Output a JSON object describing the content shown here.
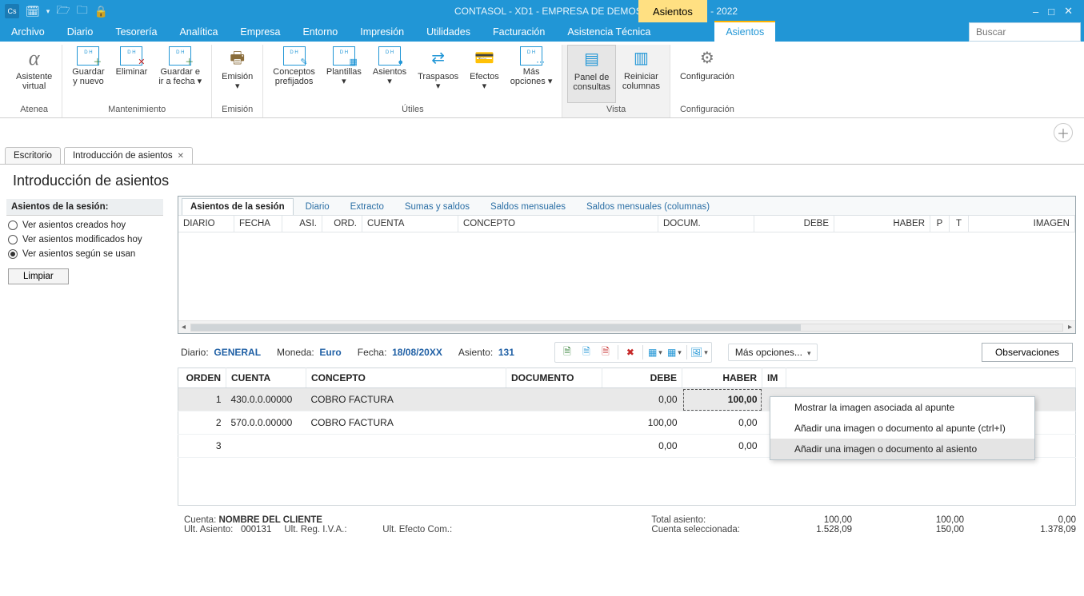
{
  "title": "CONTASOL - XD1 - EMPRESA DE DEMOSTRACION, S.L. - 2022",
  "context_tab": "Asientos",
  "window_buttons": {
    "min": "–",
    "max": "□",
    "close": "✕"
  },
  "search_placeholder": "Buscar",
  "menu": [
    "Archivo",
    "Diario",
    "Tesorería",
    "Analítica",
    "Empresa",
    "Entorno",
    "Impresión",
    "Utilidades",
    "Facturación",
    "Asistencia Técnica",
    "Asientos"
  ],
  "ribbon": {
    "groups": [
      {
        "label": "Atenea",
        "items": [
          {
            "l1": "Asistente",
            "l2": "virtual",
            "icon": "alpha"
          }
        ]
      },
      {
        "label": "Mantenimiento",
        "items": [
          {
            "l1": "Guardar",
            "l2": "y nuevo",
            "icon": "dh",
            "badge": "+",
            "color": "#2e7d32"
          },
          {
            "l1": "Eliminar",
            "l2": "",
            "icon": "dh",
            "badge": "✕",
            "color": "#c62828"
          },
          {
            "l1": "Guardar e",
            "l2": "ir a fecha ▾",
            "icon": "dh",
            "badge": "+",
            "color": "#2e7d32"
          }
        ]
      },
      {
        "label": "Emisión",
        "items": [
          {
            "l1": "Emisión",
            "l2": "▾",
            "icon": "emit"
          }
        ]
      },
      {
        "label": "Útiles",
        "items": [
          {
            "l1": "Conceptos",
            "l2": "prefijados",
            "icon": "dh",
            "badge": "✎"
          },
          {
            "l1": "Plantillas",
            "l2": "▾",
            "icon": "dh",
            "badge": "▦"
          },
          {
            "l1": "Asientos",
            "l2": "▾",
            "icon": "dh",
            "badge": "●"
          },
          {
            "l1": "Traspasos",
            "l2": "▾",
            "icon": "swap"
          },
          {
            "l1": "Efectos",
            "l2": "▾",
            "icon": "fx"
          },
          {
            "l1": "Más",
            "l2": "opciones ▾",
            "icon": "dh",
            "badge": "⋯"
          }
        ]
      },
      {
        "label": "Vista",
        "highlight": true,
        "items": [
          {
            "l1": "Panel de",
            "l2": "consultas",
            "icon": "panel",
            "active": true
          },
          {
            "l1": "Reiniciar",
            "l2": "columnas",
            "icon": "cols"
          }
        ]
      },
      {
        "label": "Configuración",
        "items": [
          {
            "l1": "Configuración",
            "l2": "",
            "icon": "gear"
          }
        ]
      }
    ]
  },
  "doc_tabs": [
    {
      "label": "Escritorio",
      "active": false,
      "close": false
    },
    {
      "label": "Introducción de asientos",
      "active": true,
      "close": true
    }
  ],
  "page_title": "Introducción de asientos",
  "side": {
    "header": "Asientos de la sesión:",
    "options": [
      {
        "label": "Ver asientos creados hoy",
        "selected": false
      },
      {
        "label": "Ver asientos modificados hoy",
        "selected": false
      },
      {
        "label": "Ver asientos según se usan",
        "selected": true
      }
    ],
    "clear_btn": "Limpiar"
  },
  "inner_tabs": [
    "Asientos de la sesión",
    "Diario",
    "Extracto",
    "Sumas y saldos",
    "Saldos mensuales",
    "Saldos mensuales (columnas)"
  ],
  "grid_cols": [
    "DIARIO",
    "FECHA",
    "ASI.",
    "ORD.",
    "CUENTA",
    "CONCEPTO",
    "DOCUM.",
    "DEBE",
    "HABER",
    "P",
    "T",
    "IMAGEN"
  ],
  "entry_bar": {
    "diario_l": "Diario:",
    "diario_v": "GENERAL",
    "moneda_l": "Moneda:",
    "moneda_v": "Euro",
    "fecha_l": "Fecha:",
    "fecha_v": "18/08/20XX",
    "asiento_l": "Asiento:",
    "asiento_v": "131",
    "more_l": "Más opciones...",
    "obs": "Observaciones"
  },
  "entries": {
    "cols": [
      "ORDEN",
      "CUENTA",
      "CONCEPTO",
      "DOCUMENTO",
      "DEBE",
      "HABER",
      "IM"
    ],
    "rows": [
      {
        "orden": "1",
        "cuenta": "430.0.0.00000",
        "concepto": "COBRO FACTURA",
        "doc": "",
        "debe": "0,00",
        "haber": "100,00",
        "sel": true
      },
      {
        "orden": "2",
        "cuenta": "570.0.0.00000",
        "concepto": "COBRO FACTURA",
        "doc": "",
        "debe": "100,00",
        "haber": "0,00",
        "sel": false
      },
      {
        "orden": "3",
        "cuenta": "",
        "concepto": "",
        "doc": "",
        "debe": "0,00",
        "haber": "0,00",
        "sel": false
      }
    ]
  },
  "context_menu": [
    {
      "label": "Mostrar la imagen asociada al apunte"
    },
    {
      "label": "Añadir una imagen o documento al apunte (ctrl+I)"
    },
    {
      "label": "Añadir una imagen o documento al asiento",
      "hover": true
    }
  ],
  "footer": {
    "cuenta_l": "Cuenta:",
    "cuenta_v": "NOMBRE DEL CLIENTE",
    "ultas_l": "Ult. Asiento:",
    "ultas_v": "000131",
    "ultreg_l": "Ult. Reg. I.V.A.:",
    "ultreg_v": "",
    "ultef_l": "Ult. Efecto Com.:",
    "ultef_v": "",
    "total_l": "Total asiento:",
    "total_d": "100,00",
    "total_h": "100,00",
    "total_s": "0,00",
    "csel_l": "Cuenta seleccionada:",
    "csel_d": "1.528,09",
    "csel_h": "150,00",
    "csel_s": "1.378,09"
  }
}
